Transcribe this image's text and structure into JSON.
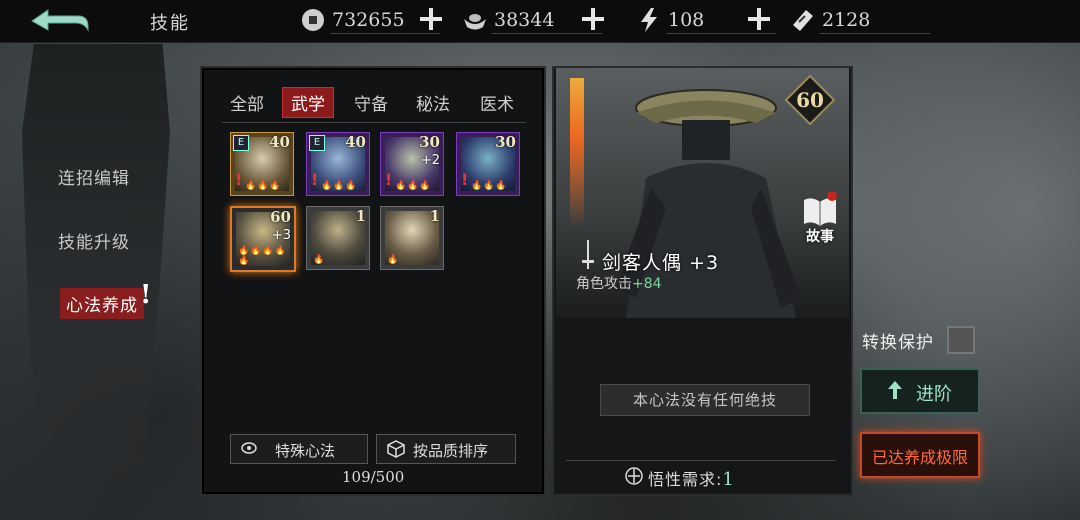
{
  "header": {
    "title": "技能",
    "resources": [
      {
        "icon": "coin-icon",
        "value": "732655"
      },
      {
        "icon": "silver-ingot-icon",
        "value": "38344"
      },
      {
        "icon": "lightning-icon",
        "value": "108"
      },
      {
        "icon": "ticket-icon",
        "value": "2128"
      }
    ]
  },
  "sidebar": {
    "items": [
      {
        "label": "连招编辑"
      },
      {
        "label": "技能升级"
      },
      {
        "label": "心法养成"
      }
    ],
    "alert": "!"
  },
  "middle": {
    "tabs": [
      {
        "label": "全部"
      },
      {
        "label": "武学"
      },
      {
        "label": "守备"
      },
      {
        "label": "秘法"
      },
      {
        "label": "医术"
      }
    ],
    "cards": [
      {
        "level": "40",
        "plus": "",
        "badge": "E",
        "alert": "!",
        "flames": "🔥🔥🔥"
      },
      {
        "level": "40",
        "plus": "",
        "badge": "E",
        "alert": "!",
        "flames": "🔥🔥🔥"
      },
      {
        "level": "30",
        "plus": "+2",
        "badge": "",
        "alert": "!",
        "flames": "🔥🔥🔥"
      },
      {
        "level": "30",
        "plus": "",
        "badge": "",
        "alert": "!",
        "flames": "🔥🔥🔥"
      },
      {
        "level": "60",
        "plus": "+3",
        "badge": "",
        "alert": "",
        "flames": "🔥🔥🔥🔥🔥"
      },
      {
        "level": "1",
        "plus": "",
        "badge": "",
        "alert": "",
        "flames": "🔥"
      },
      {
        "level": "1",
        "plus": "",
        "badge": "",
        "alert": "",
        "flames": "🔥"
      }
    ],
    "special_btn": "特殊心法",
    "sort_btn": "按品质排序",
    "count": "109/500"
  },
  "detail": {
    "level": "60",
    "story_label": "故事",
    "name": "剑客人偶 +3",
    "stat_label": "角色攻击",
    "stat_value": "+84",
    "no_skill": "本心法没有任何绝技",
    "wuxing_label": "悟性需求:",
    "wuxing_value": "1"
  },
  "actions": {
    "convert_label": "转换保护",
    "advance": "进阶",
    "max": "已达养成极限"
  }
}
